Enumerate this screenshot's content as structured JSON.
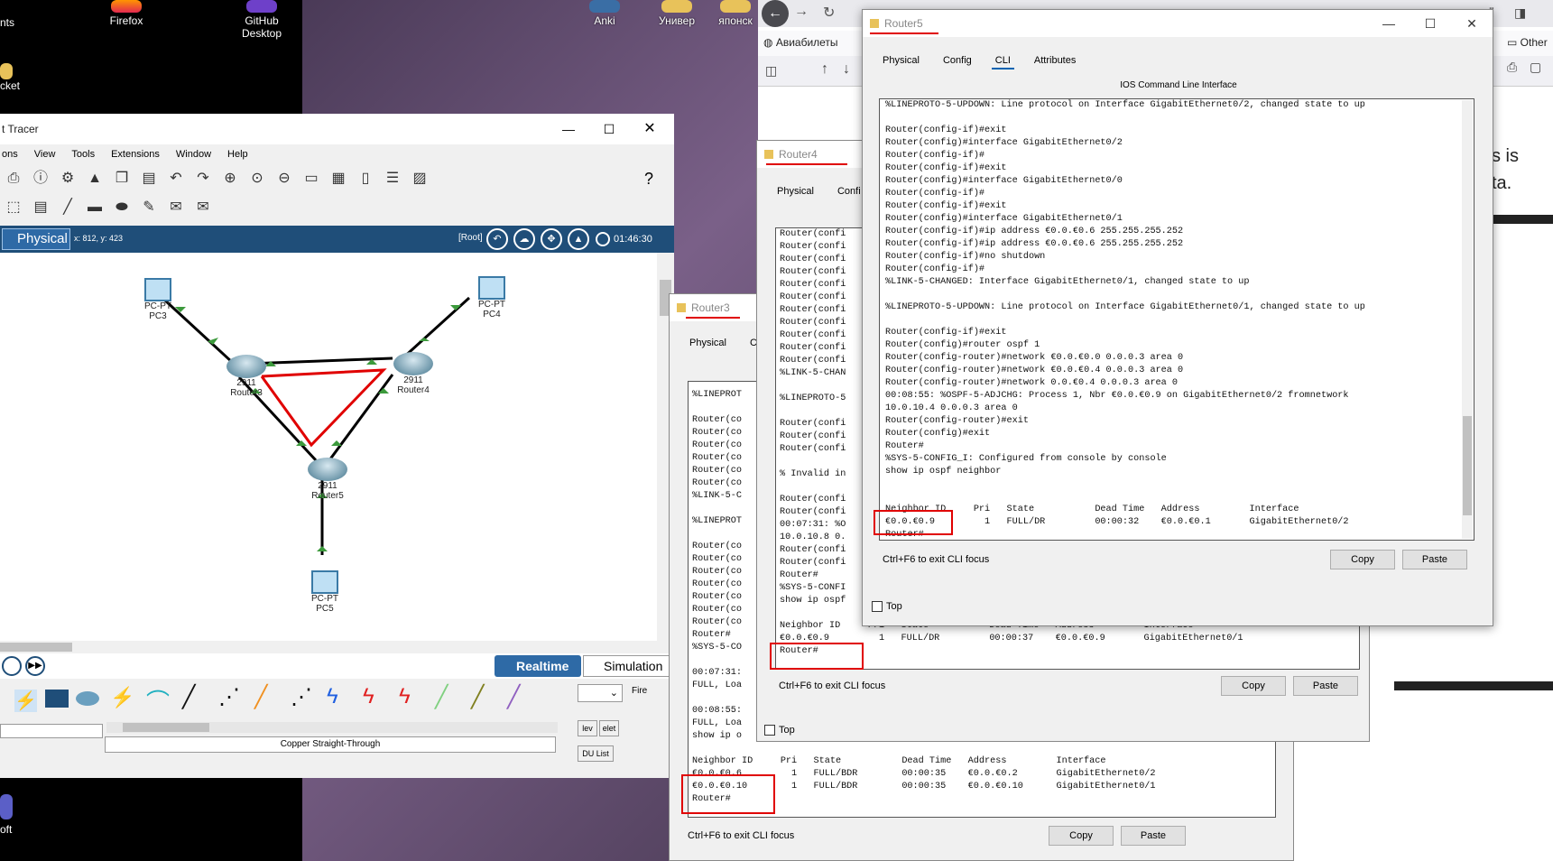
{
  "desktop": {
    "icons": [
      {
        "label": "nts"
      },
      {
        "label": "Firefox"
      },
      {
        "label": "GitHub\nDesktop"
      },
      {
        "label": "Anki"
      },
      {
        "label": "Универ"
      },
      {
        "label": "японск"
      },
      {
        "label": "cket"
      },
      {
        "label": "oft"
      }
    ]
  },
  "browser": {
    "bookmark": "Авиабилеты",
    "other_bookmarks": "Other",
    "page_text_1": "s is",
    "page_text_2": "ta."
  },
  "packet_tracer": {
    "title": "t Tracer",
    "menu": [
      "ons",
      "View",
      "Tools",
      "Extensions",
      "Window",
      "Help"
    ],
    "mode": "Physical",
    "coords": "x: 812, y: 423",
    "root": "[Root]",
    "time": "01:46:30",
    "realtime": "Realtime",
    "simulation": "Simulation",
    "cable_label": "Copper Straight-Through",
    "side_buttons": [
      "Fire",
      "lev",
      "elet",
      "DU List"
    ],
    "devices": {
      "pc3": {
        "type": "PC-PT",
        "name": "PC3"
      },
      "pc4": {
        "type": "PC-PT",
        "name": "PC4"
      },
      "pc5": {
        "type": "PC-PT",
        "name": "PC5"
      },
      "r3": {
        "model": "2911",
        "name": "Router3"
      },
      "r4": {
        "model": "2911",
        "name": "Router4"
      },
      "r5": {
        "model": "2911",
        "name": "Router5"
      }
    }
  },
  "router3": {
    "title": "Router3",
    "tabs": [
      "Physical",
      "C"
    ],
    "cli_lines": [
      "%LINEPROT",
      "",
      "Router(co",
      "Router(co",
      "Router(co",
      "Router(co",
      "Router(co",
      "Router(co",
      "%LINK-5-C",
      "",
      "%LINEPROT",
      "",
      "Router(co",
      "Router(co",
      "Router(co",
      "Router(co",
      "Router(co",
      "Router(co",
      "Router(co",
      "Router#",
      "%SYS-5-CO",
      "",
      "00:07:31:",
      "FULL, Loa",
      "",
      "00:08:55:",
      "FULL, Loa",
      "show ip o",
      "",
      "Neighbor ID     Pri   State           Dead Time   Address         Interface",
      "€0.0.€0.6         1   FULL/BDR        00:00:35    €0.0.€0.2       GigabitEthernet0/2",
      "€0.0.€0.10        1   FULL/BDR        00:00:35    €0.0.€0.10      GigabitEthernet0/1",
      "Router#"
    ],
    "exit_hint": "Ctrl+F6 to exit CLI focus",
    "copy": "Copy",
    "paste": "Paste"
  },
  "router4": {
    "title": "Router4",
    "tabs": [
      "Physical",
      "Confi"
    ],
    "cli_lines": [
      "Router(confi",
      "Router(confi",
      "Router(confi",
      "Router(confi",
      "Router(confi",
      "Router(confi",
      "Router(confi",
      "Router(confi",
      "Router(confi",
      "Router(confi",
      "Router(confi",
      "%LINK-5-CHAN",
      "",
      "%LINEPROTO-5",
      "",
      "Router(confi",
      "Router(confi",
      "Router(confi",
      "",
      "% Invalid in",
      "",
      "Router(confi",
      "Router(confi",
      "00:07:31: %O",
      "10.0.10.8 0.",
      "Router(confi",
      "Router(confi",
      "Router#",
      "%SYS-5-CONFI",
      "show ip ospf",
      "",
      "Neighbor ID     Pri   State           Dead Time   Address         Interface",
      "€0.0.€0.9         1   FULL/DR         00:00:37    €0.0.€0.9       GigabitEthernet0/1",
      "Router#"
    ],
    "exit_hint": "Ctrl+F6 to exit CLI focus",
    "copy": "Copy",
    "paste": "Paste",
    "top": "Top"
  },
  "router5": {
    "title": "Router5",
    "tabs": [
      "Physical",
      "Config",
      "CLI",
      "Attributes"
    ],
    "cli_title": "IOS Command Line Interface",
    "cli_lines": [
      "%LINEPROTO-5-UPDOWN: Line protocol on Interface GigabitEthernet0/2, changed state to up",
      "",
      "Router(config-if)#exit",
      "Router(config)#interface GigabitEthernet0/2",
      "Router(config-if)#",
      "Router(config-if)#exit",
      "Router(config)#interface GigabitEthernet0/0",
      "Router(config-if)#",
      "Router(config-if)#exit",
      "Router(config)#interface GigabitEthernet0/1",
      "Router(config-if)#ip address €0.0.€0.6 255.255.255.252",
      "Router(config-if)#ip address €0.0.€0.6 255.255.255.252",
      "Router(config-if)#no shutdown",
      "Router(config-if)#",
      "%LINK-5-CHANGED: Interface GigabitEthernet0/1, changed state to up",
      "",
      "%LINEPROTO-5-UPDOWN: Line protocol on Interface GigabitEthernet0/1, changed state to up",
      "",
      "Router(config-if)#exit",
      "Router(config)#router ospf 1",
      "Router(config-router)#network €0.0.€0.0 0.0.0.3 area 0",
      "Router(config-router)#network €0.0.€0.4 0.0.0.3 area 0",
      "Router(config-router)#network 0.0.€0.4 0.0.0.3 area 0",
      "00:08:55: %OSPF-5-ADJCHG: Process 1, Nbr €0.0.€0.9 on GigabitEthernet0/2 fromnetwork",
      "10.0.10.4 0.0.0.3 area 0",
      "Router(config-router)#exit",
      "Router(config)#exit",
      "Router#",
      "%SYS-5-CONFIG_I: Configured from console by console",
      "show ip ospf neighbor",
      "",
      "",
      "Neighbor ID     Pri   State           Dead Time   Address         Interface",
      "€0.0.€0.9         1   FULL/DR         00:00:32    €0.0.€0.1       GigabitEthernet0/2",
      "Router#"
    ],
    "exit_hint": "Ctrl+F6 to exit CLI focus",
    "copy": "Copy",
    "paste": "Paste",
    "top": "Top"
  },
  "colors": {
    "highlight": "#e00000",
    "pt_blue": "#1f4e79",
    "link_green": "#3c9a3c"
  }
}
